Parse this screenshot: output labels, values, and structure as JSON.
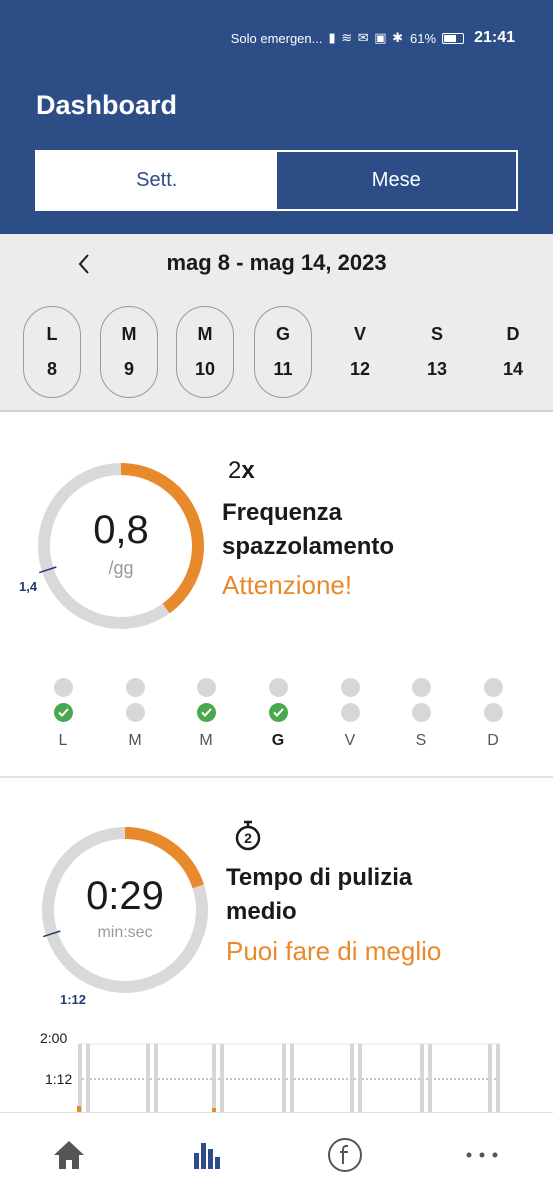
{
  "status_bar": {
    "carrier": "Solo emergen...",
    "battery": "61%",
    "time": "21:41"
  },
  "header": {
    "title": "Dashboard",
    "segments": [
      {
        "label": "Sett.",
        "active": true
      },
      {
        "label": "Mese",
        "active": false
      }
    ]
  },
  "week": {
    "range": "mag 8 - mag 14, 2023",
    "days": [
      {
        "letter": "L",
        "num": "8",
        "brushed": true
      },
      {
        "letter": "M",
        "num": "9",
        "brushed": true
      },
      {
        "letter": "M",
        "num": "10",
        "brushed": true
      },
      {
        "letter": "G",
        "num": "11",
        "brushed": true
      },
      {
        "letter": "V",
        "num": "12",
        "brushed": false
      },
      {
        "letter": "S",
        "num": "13",
        "brushed": false
      },
      {
        "letter": "D",
        "num": "14",
        "brushed": false
      }
    ]
  },
  "frequency": {
    "value": "0,8",
    "unit": "/gg",
    "target_label": "1,4",
    "goal_number": "2",
    "goal_suffix": "x",
    "title_line1": "Frequenza",
    "title_line2": "spazzolamento",
    "status": "Attenzione!",
    "progress_fraction": 0.4,
    "target_fraction": 0.7,
    "day_labels": [
      "L",
      "M",
      "M",
      "G",
      "V",
      "S",
      "D"
    ],
    "today_index": 3,
    "sessions": [
      [
        false,
        true
      ],
      [
        false,
        false
      ],
      [
        false,
        true
      ],
      [
        false,
        true
      ],
      [
        false,
        false
      ],
      [
        false,
        false
      ],
      [
        false,
        false
      ]
    ]
  },
  "duration": {
    "value": "0:29",
    "unit": "min:sec",
    "target_label": "1:12",
    "goal_number": "2",
    "title_line1": "Tempo di pulizia",
    "title_line2": "medio",
    "status": "Puoi fare di meglio",
    "progress_fraction": 0.2,
    "target_fraction": 0.7
  },
  "duration_chart": {
    "y_labels": [
      "2:00",
      "1:12"
    ]
  },
  "bottom_nav": {
    "items": [
      "home-icon",
      "stats-icon",
      "philips-icon",
      "more-icon"
    ],
    "active": "stats-icon"
  },
  "colors": {
    "header_blue": "#2c4d86",
    "accent_orange": "#e8892c",
    "ring_grey": "#d9d9d9",
    "success_green": "#4aa84f"
  }
}
